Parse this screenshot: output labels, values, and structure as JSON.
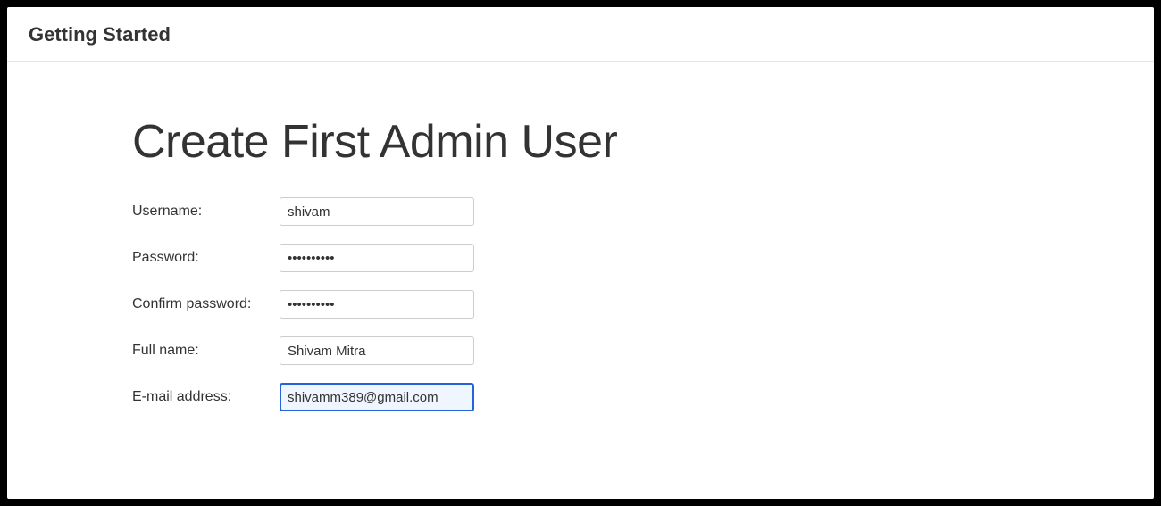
{
  "header": {
    "title": "Getting Started"
  },
  "main": {
    "heading": "Create First Admin User"
  },
  "form": {
    "username": {
      "label": "Username:",
      "value": "shivam"
    },
    "password": {
      "label": "Password:",
      "value": "••••••••••"
    },
    "confirmPassword": {
      "label": "Confirm password:",
      "value": "••••••••••"
    },
    "fullName": {
      "label": "Full name:",
      "value": "Shivam Mitra"
    },
    "email": {
      "label": "E-mail address:",
      "value": "shivamm389@gmail.com"
    }
  }
}
